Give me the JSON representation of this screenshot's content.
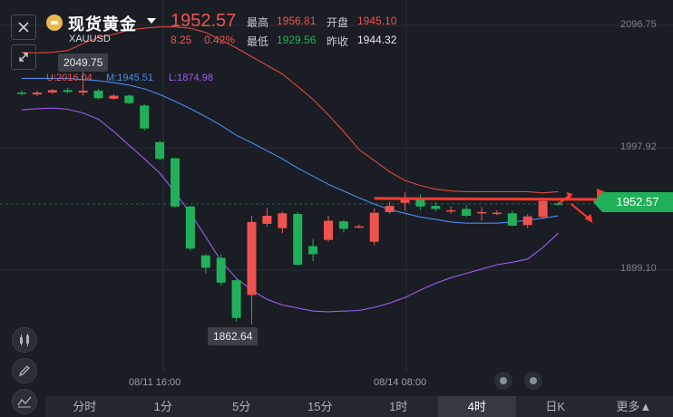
{
  "header": {
    "title": "现货黄金",
    "symbol": "XAUUSD",
    "price": "1952.57",
    "change": "8.25",
    "change_pct": "0.42%",
    "high_label": "最高",
    "high_value": "1956.81",
    "open_label": "开盘",
    "open_value": "1945.10",
    "low_label": "最低",
    "low_value": "1929.56",
    "prevclose_label": "昨收",
    "prevclose_value": "1944.32"
  },
  "indicator": {
    "upper": "U:2016.04",
    "middle": "M:1945.51",
    "lower": "L:1874.98"
  },
  "tags": {
    "peak": "2049.75",
    "trough": "1862.64",
    "current": "1952.57"
  },
  "axis": {
    "y_labels": [
      "2096.75",
      "1997.92",
      "1899.10"
    ],
    "x_labels": [
      "08/11 16:00",
      "08/14 08:00"
    ]
  },
  "tabs": [
    "分时",
    "1分",
    "5分",
    "15分",
    "1时",
    "4时",
    "日K",
    "更多▲"
  ],
  "active_tab": "4时",
  "colors": {
    "up": "#ef5350",
    "down": "#21b05a",
    "upper_band": "#e0483e",
    "middle_band": "#4a8df0",
    "lower_band": "#9b5cf0",
    "accent_arrow": "#ff3b30"
  },
  "chart_data": {
    "type": "candlestick",
    "ylim": [
      1850,
      2100
    ],
    "candles": [
      {
        "o": 2042.5,
        "c": 2041.5,
        "h": 2044.0,
        "l": 2040.0
      },
      {
        "o": 2041.0,
        "c": 2042.5,
        "h": 2044.0,
        "l": 2039.5
      },
      {
        "o": 2042.5,
        "c": 2044.5,
        "h": 2045.5,
        "l": 2041.5
      },
      {
        "o": 2044.5,
        "c": 2043.0,
        "h": 2046.5,
        "l": 2042.0
      },
      {
        "o": 2042.5,
        "c": 2044.0,
        "h": 2049.75,
        "l": 2040.0
      },
      {
        "o": 2044.0,
        "c": 2038.0,
        "h": 2045.5,
        "l": 2037.0
      },
      {
        "o": 2037.5,
        "c": 2040.0,
        "h": 2041.5,
        "l": 2036.5
      },
      {
        "o": 2040.0,
        "c": 2034.0,
        "h": 2041.0,
        "l": 2033.0
      },
      {
        "o": 2032.0,
        "c": 2013.5,
        "h": 2033.0,
        "l": 2012.0
      },
      {
        "o": 2002.5,
        "c": 1989.0,
        "h": 2003.5,
        "l": 1988.0
      },
      {
        "o": 1989.5,
        "c": 1950.5,
        "h": 1990.0,
        "l": 1949.5
      },
      {
        "o": 1950.5,
        "c": 1916.5,
        "h": 1951.0,
        "l": 1915.0
      },
      {
        "o": 1911.0,
        "c": 1901.0,
        "h": 1912.0,
        "l": 1896.5
      },
      {
        "o": 1909.0,
        "c": 1889.0,
        "h": 1912.0,
        "l": 1886.5
      },
      {
        "o": 1891.0,
        "c": 1860.5,
        "h": 1892.0,
        "l": 1857.5
      },
      {
        "o": 1879.0,
        "c": 1938.0,
        "h": 1943.0,
        "l": 1862.64
      },
      {
        "o": 1936.5,
        "c": 1943.0,
        "h": 1949.5,
        "l": 1934.0
      },
      {
        "o": 1933.0,
        "c": 1945.0,
        "h": 1946.5,
        "l": 1929.0
      },
      {
        "o": 1944.5,
        "c": 1903.5,
        "h": 1946.0,
        "l": 1902.5
      },
      {
        "o": 1918.5,
        "c": 1912.0,
        "h": 1924.0,
        "l": 1906.5
      },
      {
        "o": 1923.5,
        "c": 1939.0,
        "h": 1943.0,
        "l": 1922.0
      },
      {
        "o": 1938.5,
        "c": 1932.5,
        "h": 1939.5,
        "l": 1929.5
      },
      {
        "o": 1934.5,
        "c": 1934.5,
        "h": 1936.0,
        "l": 1933.0
      },
      {
        "o": 1922.0,
        "c": 1945.5,
        "h": 1949.0,
        "l": 1919.0
      },
      {
        "o": 1946.0,
        "c": 1951.0,
        "h": 1954.5,
        "l": 1944.5
      },
      {
        "o": 1953.5,
        "c": 1957.5,
        "h": 1962.0,
        "l": 1947.0
      },
      {
        "o": 1956.0,
        "c": 1950.5,
        "h": 1960.5,
        "l": 1947.5
      },
      {
        "o": 1951.0,
        "c": 1948.5,
        "h": 1954.0,
        "l": 1946.5
      },
      {
        "o": 1947.5,
        "c": 1947.5,
        "h": 1950.5,
        "l": 1944.5
      },
      {
        "o": 1948.5,
        "c": 1943.0,
        "h": 1952.0,
        "l": 1942.0
      },
      {
        "o": 1946.0,
        "c": 1946.0,
        "h": 1950.0,
        "l": 1939.0
      },
      {
        "o": 1944.5,
        "c": 1945.5,
        "h": 1947.5,
        "l": 1943.5
      },
      {
        "o": 1945.0,
        "c": 1935.0,
        "h": 1947.0,
        "l": 1934.5
      },
      {
        "o": 1935.5,
        "c": 1942.5,
        "h": 1944.5,
        "l": 1933.0
      },
      {
        "o": 1942.0,
        "c": 1955.0,
        "h": 1956.5,
        "l": 1940.5
      },
      {
        "o": 1953.0,
        "c": 1952.57,
        "h": 1954.0,
        "l": 1951.0
      }
    ],
    "bands": {
      "upper": [
        2075.0,
        2074.5,
        2075.0,
        2076.5,
        2082.0,
        2087.0,
        2089.5,
        2093.0,
        2094.5,
        2095.5,
        2095.5,
        2094.5,
        2091.0,
        2085.0,
        2078.5,
        2071.5,
        2064.5,
        2057.5,
        2047.5,
        2037.0,
        2024.5,
        2011.0,
        1996.5,
        1987.5,
        1978.5,
        1971.5,
        1967.5,
        1964.5,
        1963.0,
        1962.5,
        1962.5,
        1962.5,
        1962.5,
        1962.5,
        1961.5,
        1962.5
      ],
      "middle": [
        2054.0,
        2054.0,
        2054.0,
        2054.0,
        2053.0,
        2052.0,
        2050.5,
        2048.5,
        2045.5,
        2041.0,
        2035.5,
        2029.5,
        2023.0,
        2016.0,
        2008.0,
        2002.0,
        1995.5,
        1989.0,
        1981.5,
        1975.0,
        1968.5,
        1963.0,
        1957.5,
        1952.5,
        1948.0,
        1945.0,
        1942.0,
        1940.0,
        1938.0,
        1937.0,
        1937.0,
        1937.0,
        1938.0,
        1939.5,
        1941.0,
        1943.0
      ],
      "lower": [
        2028.5,
        2029.5,
        2030.0,
        2029.0,
        2026.0,
        2021.0,
        2011.0,
        2000.0,
        1989.0,
        1977.5,
        1962.0,
        1945.0,
        1926.0,
        1906.5,
        1892.5,
        1883.0,
        1875.5,
        1871.0,
        1868.5,
        1866.0,
        1865.5,
        1866.0,
        1866.5,
        1869.0,
        1872.5,
        1877.0,
        1883.0,
        1888.5,
        1893.0,
        1896.5,
        1900.0,
        1903.5,
        1905.5,
        1908.0,
        1917.5,
        1929.0
      ]
    }
  }
}
